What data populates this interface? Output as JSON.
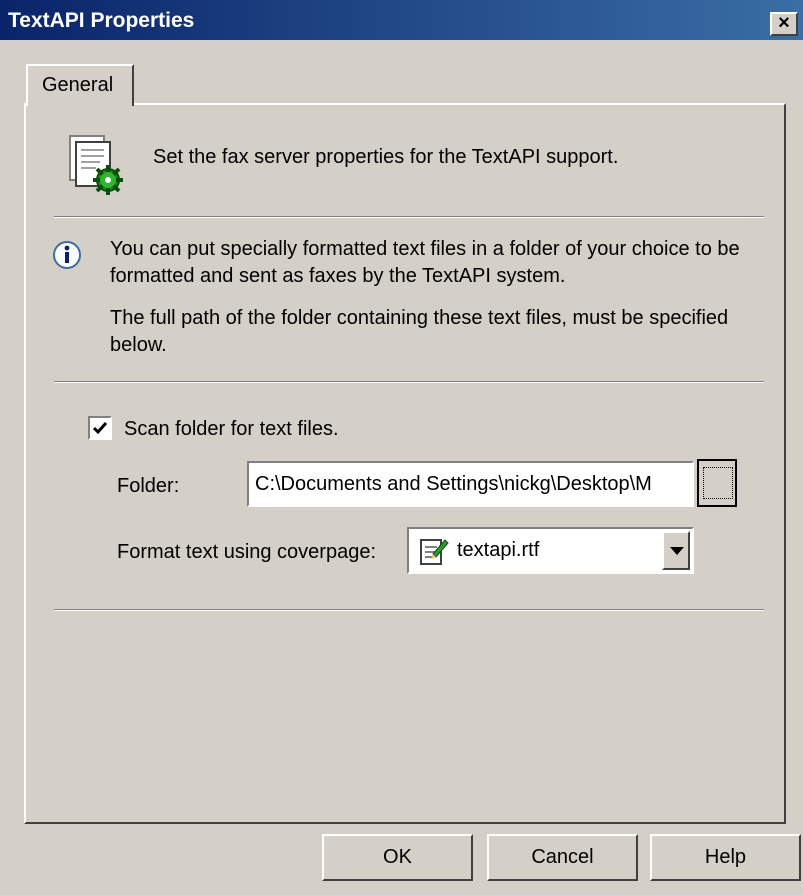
{
  "window": {
    "title": "TextAPI Properties",
    "close_label": "×"
  },
  "tabs": [
    {
      "label": "General",
      "selected": true
    }
  ],
  "general": {
    "description": "Set the fax server properties for the TextAPI support.",
    "info_line1": "You can put specially formatted text files in a folder of your choice to be formatted and sent as faxes by the TextAPI system.",
    "info_line2": "The full path of the folder containing these text files, must be specified below.",
    "scan_checkbox": {
      "label": "Scan folder for text files.",
      "checked": true
    },
    "folder": {
      "label": "Folder:",
      "value": "C:\\Documents and Settings\\nickg\\Desktop\\M"
    },
    "coverpage": {
      "label": "Format text using coverpage:",
      "selected": "textapi.rtf"
    }
  },
  "buttons": {
    "ok": "OK",
    "cancel": "Cancel",
    "help": "Help"
  },
  "icons": {
    "description": "document-settings-icon",
    "info": "info-icon",
    "coverpage": "coverpage-file-icon",
    "dropdown": "dropdown-arrow-icon",
    "browse": "browse-icon"
  },
  "colors": {
    "titlebar_start": "#0a246a",
    "titlebar_end": "#3a6ea5",
    "face": "#d4d0c8"
  }
}
